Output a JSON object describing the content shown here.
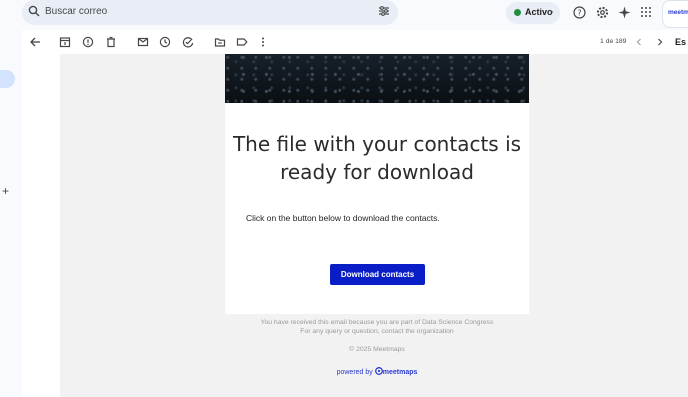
{
  "search": {
    "placeholder": "Buscar correo"
  },
  "status": {
    "label": "Activo"
  },
  "brand_chip": "meetmaps",
  "pagination": {
    "label": "1 de 189"
  },
  "toolbar": {
    "trailing_label": "Es"
  },
  "email": {
    "headline_line1": "The file with your contacts is",
    "headline_line2": "ready for download",
    "body": "Click on the button below to download the contacts.",
    "button_label": "Download contacts",
    "footer_line1": "You have received this email because you are part of Data Science Congress",
    "footer_line2": "For any query or question, contact the organization",
    "copyright": "© 2025 Meetmaps",
    "powered_prefix": "powered by",
    "powered_brand": "meetmaps"
  },
  "colors": {
    "accent": "#0a1ec8",
    "active_status": "#1e8e3e",
    "brand_link": "#2b3bcf"
  },
  "icons": [
    "search-icon",
    "filter-icon",
    "help-icon",
    "settings-icon",
    "sparkle-icon",
    "apps-icon",
    "back-icon",
    "archive-icon",
    "report-icon",
    "delete-icon",
    "mark-unread-icon",
    "snooze-icon",
    "add-task-icon",
    "move-icon",
    "label-icon",
    "more-icon",
    "prev-icon",
    "next-icon",
    "plus-icon"
  ]
}
